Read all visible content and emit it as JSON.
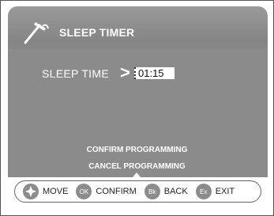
{
  "header": {
    "title": "SLEEP TIMER",
    "icon": "hammer-icon"
  },
  "sleep": {
    "label": "SLEEP TIME",
    "arrow": ">",
    "value": "01:15"
  },
  "actions": {
    "confirm": "CONFIRM PROGRAMMING",
    "cancel": "CANCEL PROGRAMMING"
  },
  "footer": {
    "move": {
      "badge": "",
      "label": "MOVE"
    },
    "ok": {
      "badge": "OK",
      "label": "CONFIRM"
    },
    "bk": {
      "badge": "Bk",
      "label": "BACK"
    },
    "ex": {
      "badge": "Ex",
      "label": "EXIT"
    }
  },
  "colors": {
    "panel": "#8b8b8b",
    "badge": "#8c8c8c",
    "text": "#ffffff"
  }
}
